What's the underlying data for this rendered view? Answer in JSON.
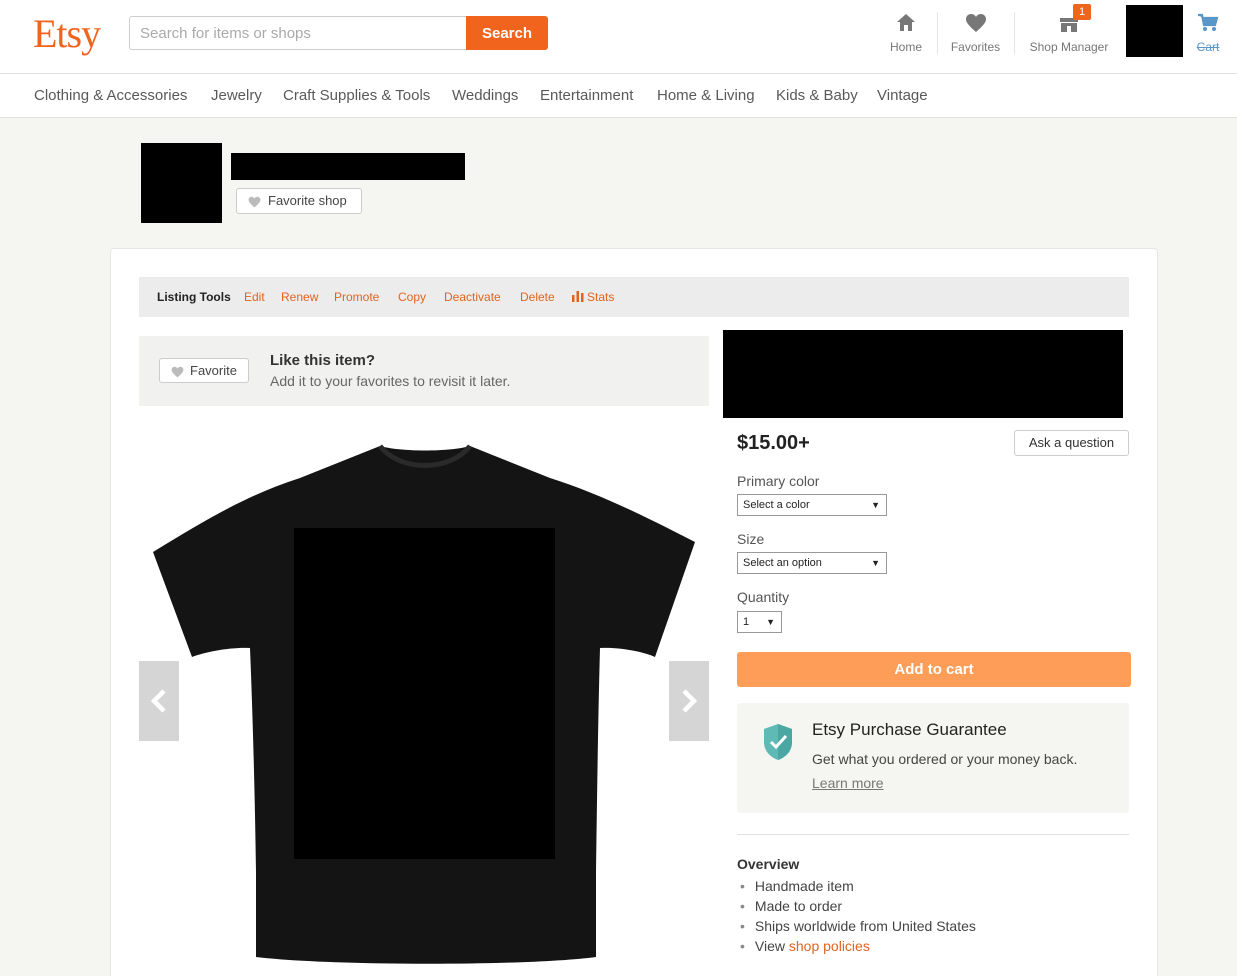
{
  "header": {
    "logo": "Etsy",
    "search_placeholder": "Search for items or shops",
    "search_button": "Search",
    "nav": {
      "home": "Home",
      "favorites": "Favorites",
      "shop_manager": "Shop Manager",
      "cart": "Cart"
    },
    "shop_manager_badge": "1"
  },
  "categories": [
    "Clothing & Accessories",
    "Jewelry",
    "Craft Supplies & Tools",
    "Weddings",
    "Entertainment",
    "Home & Living",
    "Kids & Baby",
    "Vintage"
  ],
  "shop": {
    "favorite_shop_label": "Favorite shop"
  },
  "listing_tools": {
    "title": "Listing Tools",
    "actions": [
      "Edit",
      "Renew",
      "Promote",
      "Copy",
      "Deactivate",
      "Delete",
      "Stats"
    ]
  },
  "favorite_panel": {
    "button": "Favorite",
    "title": "Like this item?",
    "subtitle": "Add it to your favorites to revisit it later."
  },
  "product": {
    "price": "$15.00+",
    "ask_question": "Ask a question",
    "primary_color_label": "Primary color",
    "primary_color_value": "Select a color",
    "size_label": "Size",
    "size_value": "Select an option",
    "quantity_label": "Quantity",
    "quantity_value": "1",
    "add_to_cart": "Add to cart"
  },
  "guarantee": {
    "title": "Etsy Purchase Guarantee",
    "subtitle": "Get what you ordered or your money back.",
    "link": "Learn more"
  },
  "overview": {
    "title": "Overview",
    "items": [
      "Handmade item",
      "Made to order",
      "Ships worldwide from United States"
    ],
    "policy_prefix": "View",
    "policy_link": "shop policies"
  },
  "colors": {
    "accent": "#f1641e",
    "cart_button": "#fd9d57",
    "shield": "#5fb9b4"
  },
  "icons": [
    "home-icon",
    "heart-icon",
    "shop-manager-icon",
    "cart-icon",
    "stats-icon",
    "shield-check-icon",
    "chevron-left-icon",
    "chevron-right-icon"
  ]
}
